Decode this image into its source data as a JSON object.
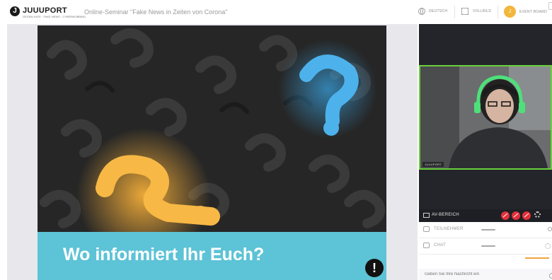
{
  "header": {
    "logo_mark": "J",
    "logo_name": "JUUUPORT",
    "logo_tagline": "GEGEN HATE · FAKE NEWS · CYBERMOBBING",
    "title": "Online-Seminar \"Fake News in Zeiten von Corona\"",
    "language_label": "DEUTSCH",
    "fullscreen_label": "VOLLBILD",
    "avatar_initial": "J",
    "eventboard_label": "EVENT BOARD"
  },
  "slide": {
    "caption": "Wo informiert Ihr Euch?",
    "warn_glyph": "!"
  },
  "video": {
    "name_tag": "JUUUPORT"
  },
  "av_panel": {
    "label": "AV-BEREICH"
  },
  "participants": {
    "label": "TEILNEHMER"
  },
  "chat": {
    "label": "CHAT",
    "placeholder": "Geben Sie Ihre Nachricht ein"
  },
  "colors": {
    "accent_teal": "#5dc3d6",
    "cam_border": "#69d03a",
    "danger_red": "#e0313b",
    "avatar_orange": "#f2b63c"
  }
}
